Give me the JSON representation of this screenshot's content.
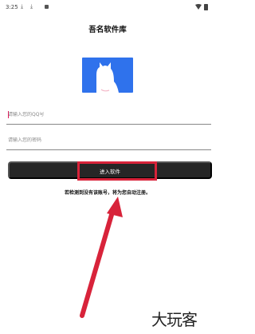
{
  "status_bar": {
    "time": "3:25",
    "download_icons": [
      "download-icon",
      "download-icon"
    ],
    "right_icons": [
      "wifi-icon",
      "battery-icon"
    ]
  },
  "app": {
    "title": "吾名软件库"
  },
  "logo": {
    "icon": "cat-logo-icon",
    "background": "#2f72ec"
  },
  "form": {
    "qq_placeholder": "请输入您的QQ号",
    "qq_value": "",
    "password_placeholder": "请输入您的密码",
    "password_value": "",
    "submit_label": "进入软件"
  },
  "notice": "若检测到没有该账号，将为您自动注册。",
  "annotation": {
    "highlight_color": "#d8233a",
    "arrow_color": "#d8233a"
  },
  "watermark": "大玩客"
}
